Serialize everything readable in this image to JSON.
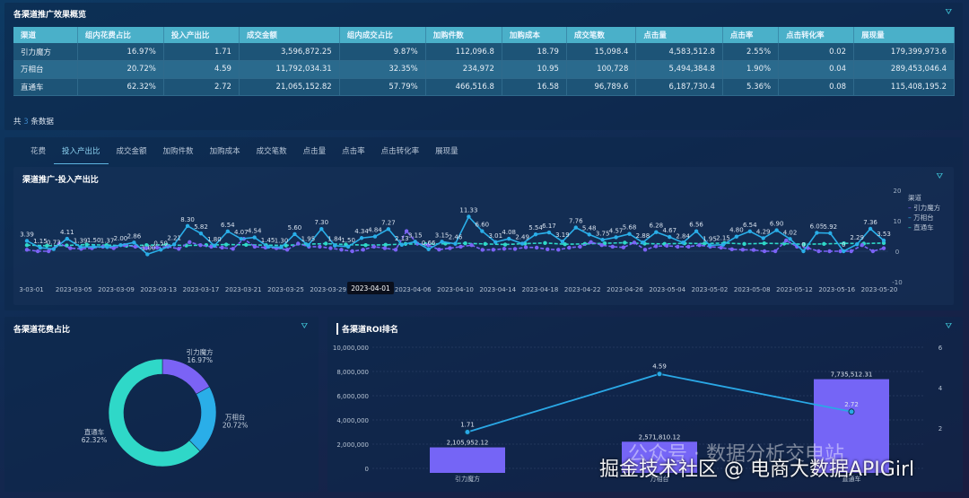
{
  "overview": {
    "title": "各渠道推广效果概览",
    "footer_prefix": "共",
    "footer_count": "3",
    "footer_suffix": "条数据",
    "columns": [
      "渠道",
      "组内花费占比",
      "投入产出比",
      "成交金额",
      "组内成交占比",
      "加购件数",
      "加购成本",
      "成交笔数",
      "点击量",
      "点击率",
      "点击转化率",
      "展现量"
    ],
    "rows": [
      [
        "引力魔方",
        "16.97%",
        "1.71",
        "3,596,872.25",
        "9.87%",
        "112,096.8",
        "18.79",
        "15,098.4",
        "4,583,512.8",
        "2.55%",
        "0.02",
        "179,399,973.6"
      ],
      [
        "万相台",
        "20.72%",
        "4.59",
        "11,792,034.31",
        "32.35%",
        "234,972",
        "10.95",
        "100,728",
        "5,494,384.8",
        "1.90%",
        "0.04",
        "289,453,046.4"
      ],
      [
        "直通车",
        "62.32%",
        "2.72",
        "21,065,152.82",
        "57.79%",
        "466,516.8",
        "16.58",
        "96,789.6",
        "6,187,730.4",
        "5.36%",
        "0.08",
        "115,408,195.2"
      ]
    ]
  },
  "tabs": [
    "花费",
    "投入产出比",
    "成交金额",
    "加购件数",
    "加购成本",
    "成交笔数",
    "点击量",
    "点击率",
    "点击转化率",
    "展现量"
  ],
  "active_tab": 1,
  "colors": {
    "yinli": "#7b63f5",
    "wanxiang": "#2aaee8",
    "zhitong": "#2fd8c8"
  },
  "chart_data": [
    {
      "type": "line",
      "title": "渠道推广-投入产出比",
      "legend_title": "渠道",
      "legend": [
        "引力魔方",
        "万相台",
        "直通车"
      ],
      "legend_position": "right",
      "ylim": [
        -10,
        20
      ],
      "yticks": [
        "20",
        "10",
        "0",
        "-10"
      ],
      "xticks": [
        "3-03-01",
        "2023-03-05",
        "2023-03-09",
        "2023-03-13",
        "2023-03-17",
        "2023-03-21",
        "2023-03-25",
        "2023-03-29",
        "2023-04-01",
        "2023-04-06",
        "2023-04-10",
        "2023-04-14",
        "2023-04-18",
        "2023-04-22",
        "2023-04-26",
        "2023-05-04",
        "2023-05-02",
        "2023-05-08",
        "2023-05-12",
        "2023-05-16",
        "2023-05-20"
      ],
      "tooltip": "2023-04-01",
      "series": [
        {
          "name": "引力魔方",
          "values": [
            0.5,
            0,
            0,
            2.5,
            1,
            0.8,
            1,
            1.5,
            1,
            2,
            1.5,
            1,
            1.2,
            1.5,
            0.8,
            3,
            2,
            1.5,
            1.2,
            0.8,
            4.07,
            1.5,
            1.2,
            1,
            0.5,
            2.5,
            1.5,
            1.5,
            1,
            0.5,
            0,
            0.5,
            1.5,
            1,
            0.5,
            6.6,
            2.5,
            2,
            0.54,
            1,
            1.5,
            2,
            0.45,
            0.5,
            0.81,
            0.76,
            1.3,
            1.2,
            0.64,
            0.5,
            1.16,
            1.5,
            3,
            2,
            1.5,
            1.26,
            2.84,
            0.5,
            1.63,
            1.8,
            1.5,
            1.5,
            2,
            1.5,
            1.2,
            0.63,
            0.5,
            0.42,
            0,
            0,
            3.54,
            1.5,
            1.06,
            0,
            0,
            0,
            0,
            2,
            0,
            0.98
          ]
        },
        {
          "name": "万相台",
          "values": [
            3.39,
            1.15,
            0.73,
            4.11,
            1.39,
            1.5,
            1.37,
            2,
            2.86,
            -1,
            0.5,
            2.21,
            8.3,
            5.82,
            1.8,
            6.54,
            4.07,
            4.54,
            1.45,
            1.3,
            5.6,
            1.95,
            7.3,
            1.84,
            1.5,
            4.34,
            4.84,
            7.27,
            2.13,
            3.15,
            0.66,
            3.15,
            2.46,
            11.33,
            6.6,
            3.01,
            4.08,
            2.49,
            5.54,
            6.17,
            3.19,
            7.76,
            5.48,
            3.75,
            4.57,
            5.68,
            2.88,
            6.28,
            4.67,
            2.84,
            6.56,
            1.95,
            2.15,
            4.8,
            6.54,
            4.29,
            6.9,
            4.02,
            0,
            6.05,
            5.92,
            0,
            2.29,
            7.36,
            3.53
          ]
        },
        {
          "name": "直通车",
          "values": [
            2,
            1.8,
            1.9,
            2.2,
            2,
            1.8,
            2,
            2.1,
            1.9,
            2,
            2.2,
            2.1,
            2,
            1.9,
            2.3,
            2.5,
            2.2,
            2,
            2.1,
            2.4,
            2.3,
            2.5,
            2.6,
            2.4,
            2.2,
            2.5,
            2.7,
            2.3,
            2.4,
            2.6,
            2.8,
            2.5,
            2.4,
            2.6,
            2.5,
            2.7,
            2.4,
            2.6,
            2.5,
            2.3,
            2.4,
            2.6,
            2.5,
            2.7
          ]
        }
      ]
    },
    {
      "type": "pie",
      "title": "各渠道花费占比",
      "labels": [
        "引力魔方",
        "万相台",
        "直通车"
      ],
      "values": [
        16.97,
        20.72,
        62.32
      ],
      "value_labels": [
        "16.97%",
        "20.72%",
        "62.32%"
      ]
    },
    {
      "type": "bar",
      "title": "各渠道ROI排名",
      "categories": [
        "引力魔方",
        "万相台",
        "直通车"
      ],
      "bar_values": [
        2105952.12,
        2571810.12,
        7735512.31
      ],
      "bar_labels": [
        "2,105,952.12",
        "2,571,810.12",
        "7,735,512.31"
      ],
      "line_values": [
        1.71,
        4.59,
        2.72
      ],
      "line_labels": [
        "1.71",
        "4.59",
        "2.72"
      ],
      "ylim_left": [
        0,
        10000000
      ],
      "yticks_left": [
        "10,000,000",
        "8,000,000",
        "6,000,000",
        "4,000,000",
        "2,000,000",
        "0"
      ],
      "yticks_right": [
        "6",
        "4",
        "2"
      ]
    }
  ],
  "watermark": {
    "line1": "公众号 · 数据分析交电站",
    "line2": "掘金技术社区 @ 电商大数据APIGirl"
  }
}
